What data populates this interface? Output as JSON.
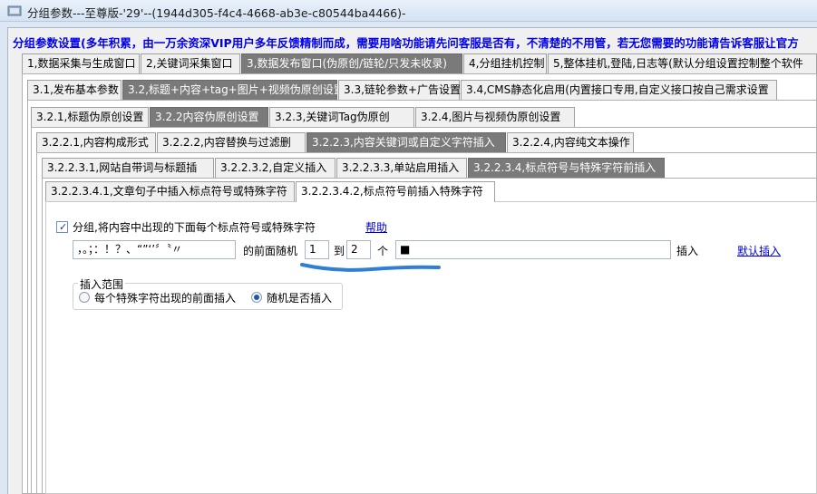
{
  "window": {
    "title": "分组参数---至尊版-'29'--(1944d305-f4c4-4668-ab3e-c80544ba4466)-"
  },
  "banner": "分组参数设置(多年积累，由一万余资深VIP用户多年反馈精制而成，需要用啥功能请先问客服是否有，不清楚的不用管，若无您需要的功能请告诉客服让官方",
  "tabs_l1": [
    "1,数据采集与生成窗口",
    "2,关键词采集窗口",
    "3,数据发布窗口(伪原创/链轮/只发未收录)",
    "4,分组挂机控制",
    "5,整体挂机,登陆,日志等(默认分组设置控制整个软件"
  ],
  "tabs_l2": [
    "3.1,发布基本参数",
    "3.2,标题+内容+tag+图片+视频伪原创设置",
    "3.3,链轮参数+广告设置",
    "3.4,CMS静态化启用(内置接口专用,自定义接口按自己需求设置"
  ],
  "tabs_l3": [
    "3.2.1,标题伪原创设置",
    "3.2.2内容伪原创设置",
    "3.2.3,关键词Tag伪原创",
    "3.2.4,图片与视频伪原创设置"
  ],
  "tabs_l4": [
    "3.2.2.1,内容构成形式",
    "3.2.2.2,内容替换与过滤删",
    "3.2.2.3,内容关键词或自定义字符插入",
    "3.2.2.4,内容纯文本操作"
  ],
  "tabs_l5": [
    "3.2.2.3.1,网站自带词与标题插",
    "3.2.2.3.2,自定义插入",
    "3.2.2.3.3,单站启用插入",
    "3.2.2.3.4,标点符号与特殊字符前插入"
  ],
  "tabs_l6": [
    "3.2.2.3.4.1,文章句子中插入标点符号或特殊字符",
    "3.2.2.3.4.2,标点符号前插入特殊字符"
  ],
  "content": {
    "checkbox_label": "分组,将内容中出现的下面每个标点符号或特殊字符",
    "checkbox_checked": true,
    "help_link": "帮助",
    "punctuation_value": "，。；：！？、“”‘’〞〝〃",
    "before_random_label": "的前面随机",
    "min_value": "1",
    "to_label": "到",
    "max_value": "2",
    "unit_label": "个",
    "insert_chars_value": "■",
    "insert_label": "插入",
    "default_insert_link": "默认插入",
    "insert_range_legend": "插入范围",
    "radio_options": [
      {
        "label": "每个特殊字符出现的前面插入",
        "checked": false
      },
      {
        "label": "随机是否插入",
        "checked": true
      }
    ]
  },
  "colors": {
    "banner": "#0000ee",
    "selected_tab": "#7a7a7a",
    "annotation": "#2f7fd6",
    "link": "#0000cc"
  }
}
